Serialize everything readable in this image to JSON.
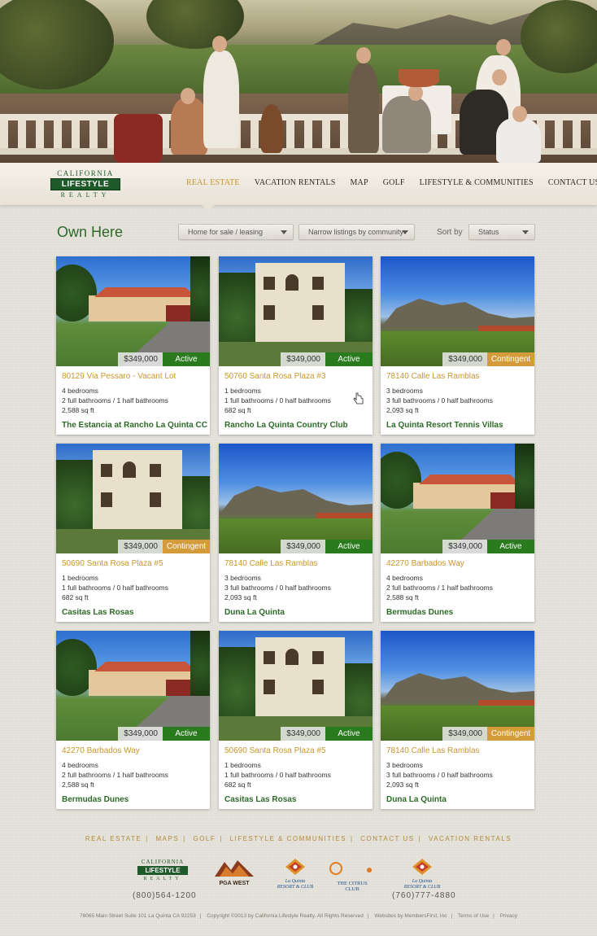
{
  "logo": {
    "line1": "CALIFORNIA",
    "line2": "LIFESTYLE",
    "line3": "REALTY"
  },
  "nav": [
    {
      "label": "REAL ESTATE",
      "active": true
    },
    {
      "label": "VACATION RENTALS"
    },
    {
      "label": "MAP"
    },
    {
      "label": "GOLF"
    },
    {
      "label": "LIFESTYLE & COMMUNITIES"
    },
    {
      "label": "CONTACT US"
    }
  ],
  "page": {
    "title": "Own Here"
  },
  "filters": {
    "type": "Home for sale / leasing",
    "community": "Narrow listings by community",
    "sort_label": "Sort by",
    "sort_value": "Status"
  },
  "listings": [
    {
      "price": "$349,000",
      "status": "Active",
      "address": "80129 Via Pessaro - Vacant Lot",
      "beds": "4 bedrooms",
      "baths": "2 full bathrooms / 1 half bathrooms",
      "sqft": "2,588 sq ft",
      "community": "The Estancia at Rancho La Quinta CC",
      "photo": "house"
    },
    {
      "price": "$349,000",
      "status": "Active",
      "address": "50760 Santa Rosa Plaza #3",
      "beds": "1 bedrooms",
      "baths": "1 full bathrooms / 0 half bathrooms",
      "sqft": "682 sq ft",
      "community": "Rancho La Quinta Country Club",
      "photo": "condo"
    },
    {
      "price": "$349,000",
      "status": "Contingent",
      "address": "78140 Calle Las Ramblas",
      "beds": "3 bedrooms",
      "baths": "3 full bathrooms / 0 half bathrooms",
      "sqft": "2,093 sq ft",
      "community": "La Quinta Resort Tennis Villas",
      "photo": "golf"
    },
    {
      "price": "$349,000",
      "status": "Contingent",
      "address": "50690 Santa Rosa Plaza #5",
      "beds": "1 bedrooms",
      "baths": "1 full bathrooms / 0 half bathrooms",
      "sqft": "682 sq ft",
      "community": "Casitas Las Rosas",
      "photo": "condo"
    },
    {
      "price": "$349,000",
      "status": "Active",
      "address": "78140 Calle Las Ramblas",
      "beds": "3 bedrooms",
      "baths": "3 full bathrooms / 0 half bathrooms",
      "sqft": "2,093 sq ft",
      "community": "Duna La Quinta",
      "photo": "golf"
    },
    {
      "price": "$349,000",
      "status": "Active",
      "address": "42270 Barbados Way",
      "beds": "4 bedrooms",
      "baths": "2 full bathrooms / 1 half bathrooms",
      "sqft": "2,588 sq ft",
      "community": "Bermudas Dunes",
      "photo": "house"
    },
    {
      "price": "$349,000",
      "status": "Active",
      "address": "42270 Barbados Way",
      "beds": "4 bedrooms",
      "baths": "2 full bathrooms / 1 half bathrooms",
      "sqft": "2,588 sq ft",
      "community": "Bermudas Dunes",
      "photo": "house"
    },
    {
      "price": "$349,000",
      "status": "Active",
      "address": "50690 Santa Rosa Plaza #5",
      "beds": "1 bedrooms",
      "baths": "1 full bathrooms / 0 half bathrooms",
      "sqft": "682 sq ft",
      "community": "Casitas Las Rosas",
      "photo": "condo"
    },
    {
      "price": "$349,000",
      "status": "Contingent",
      "address": "78140 Calle Las Ramblas",
      "beds": "3 bedrooms",
      "baths": "3 full bathrooms / 0 half bathrooms",
      "sqft": "2,093 sq ft",
      "community": "Duna La Quinta",
      "photo": "golf"
    }
  ],
  "footer": {
    "links": [
      "REAL ESTATE",
      "MAPS",
      "GOLF",
      "LIFESTYLE & COMMUNITIES",
      "CONTACT US",
      "VACATION RENTALS"
    ],
    "partner_logos": [
      "PGA WEST",
      "La Quinta RESORT & CLUB",
      "THE CITRUS CLUB",
      "La Quinta RESORT & CLUB"
    ],
    "phone_left": "(800)564-1200",
    "phone_right": "(760)777-4880",
    "address": "78065 Main Street Suite 101 La Quinta CA 92253",
    "copyright": "Copyright ©2013 by California Lifestyle Realty. All Rights Reserved",
    "credit": "Websites by MembersFirst, Inc",
    "terms": "Terms of Use",
    "privacy": "Privacy"
  },
  "colors": {
    "accent_gold": "#c9962b",
    "brand_green": "#2d6a28",
    "active": "#2a7a1e",
    "contingent": "#d49b3a"
  }
}
